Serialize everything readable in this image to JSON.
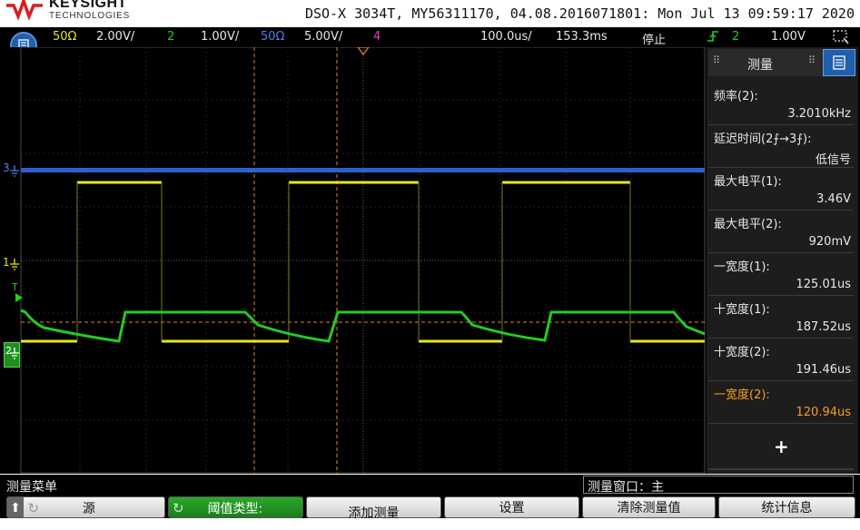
{
  "header": {
    "brand": "KEYSIGHT",
    "brand_sub": "TECHNOLOGIES",
    "instrument_info": "DSO-X 3034T, MY56311170, 04.08.2016071801: Mon Jul 13 09:59:17 2020"
  },
  "channel_bar": {
    "ch1_imp": "50Ω",
    "ch1_scale": "2.00V/",
    "ch2_num": "2",
    "ch2_scale": "1.00V/",
    "ch3_imp": "50Ω",
    "ch3_scale": "5.00V/",
    "ch4_num": "4",
    "timebase": "100.0us/",
    "delay": "153.3ms",
    "run_state": "停止",
    "trigger_src": "2",
    "trigger_level": "1.00V"
  },
  "markers": {
    "ch3": "3",
    "ch1": "1",
    "trig": "T",
    "ch2": "2"
  },
  "colors": {
    "ch1": "#e6e619",
    "ch2": "#22cc22",
    "ch3": "#2f5fd6",
    "cursor": "#e08a1a"
  },
  "measure_panel": {
    "title": "测量",
    "items": [
      {
        "label": "频率(2):",
        "value": "3.2010kHz",
        "color": "#e8e8e8"
      },
      {
        "label": "延迟时间(2⨍→3⨍):",
        "value": "低信号",
        "color": "#e8e8e8"
      },
      {
        "label": "最大电平(1):",
        "value": "3.46V",
        "color": "#e8e8e8"
      },
      {
        "label": "最大电平(2):",
        "value": "920mV",
        "color": "#e8e8e8"
      },
      {
        "label": "一宽度(1):",
        "value": "125.01us",
        "color": "#e8e8e8"
      },
      {
        "label": "十宽度(1):",
        "value": "187.52us",
        "color": "#e8e8e8"
      },
      {
        "label": "十宽度(2):",
        "value": "191.46us",
        "color": "#e8e8e8"
      },
      {
        "label": "一宽度(2):",
        "value": "120.94us",
        "color": "#f0a020"
      }
    ],
    "add": "+"
  },
  "status": {
    "menu_title": "测量菜单",
    "window_label": "测量窗口：主"
  },
  "softkeys": {
    "source": "源",
    "threshold": "阈值类型:",
    "add_measure": "添加测量",
    "settings": "设置",
    "clear": "清除测量值",
    "stats": "统计信息"
  }
}
